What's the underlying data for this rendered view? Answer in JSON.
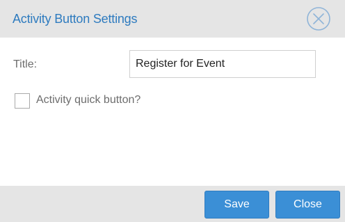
{
  "dialog": {
    "title": "Activity Button Settings"
  },
  "form": {
    "title_label": "Title:",
    "title_value": "Register for Event",
    "quick_button_label": "Activity quick button?",
    "quick_button_checked": false
  },
  "footer": {
    "save_label": "Save",
    "close_label": "Close"
  },
  "colors": {
    "accent": "#3b8fd6",
    "title_text": "#2e7bbf",
    "header_bg": "#e5e5e5",
    "label_text": "#6d6d6d"
  },
  "icons": {
    "close": "close-circle-icon"
  }
}
